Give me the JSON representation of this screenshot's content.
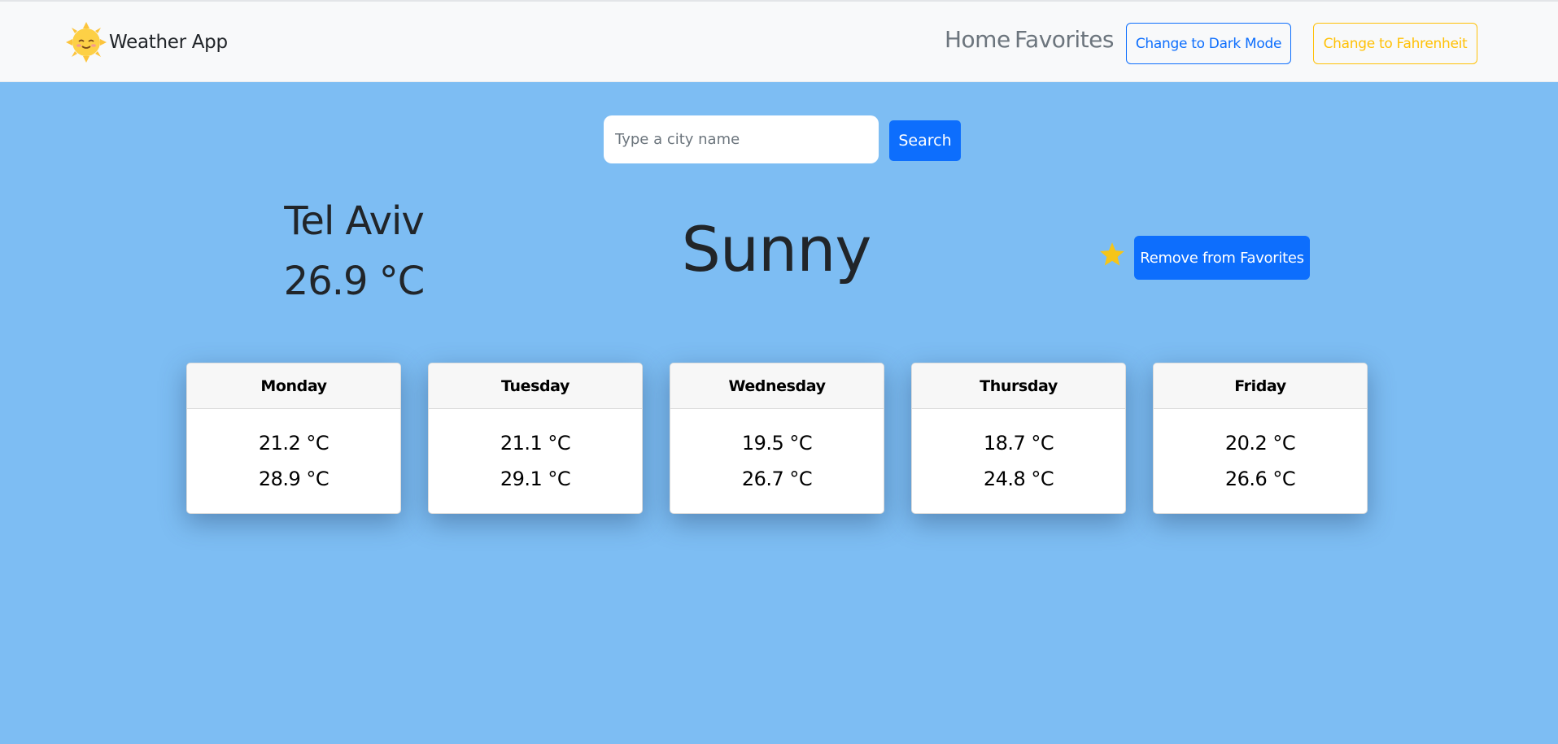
{
  "navbar": {
    "brand": "Weather App",
    "logo_icon": "sun-icon",
    "links": [
      "Home",
      "Favorites"
    ],
    "dark_mode_label": "Change to Dark Mode",
    "fahrenheit_label": "Change to Fahrenheit"
  },
  "search": {
    "placeholder": "Type a city name",
    "value": "",
    "button_label": "Search"
  },
  "current": {
    "city": "Tel Aviv",
    "temperature": "26.9 °C",
    "condition": "Sunny",
    "favorite_icon": "star-icon",
    "favorite_label": "Remove from Favorites"
  },
  "forecast": [
    {
      "day": "Monday",
      "min": "21.2 °C",
      "max": "28.9 °C"
    },
    {
      "day": "Tuesday",
      "min": "21.1 °C",
      "max": "29.1 °C"
    },
    {
      "day": "Wednesday",
      "min": "19.5 °C",
      "max": "26.7 °C"
    },
    {
      "day": "Thursday",
      "min": "18.7 °C",
      "max": "24.8 °C"
    },
    {
      "day": "Friday",
      "min": "20.2 °C",
      "max": "26.6 °C"
    }
  ],
  "colors": {
    "background": "#7dbdf3",
    "primary": "#0d6efd",
    "warning": "#ffc107",
    "star": "#f5c518"
  }
}
